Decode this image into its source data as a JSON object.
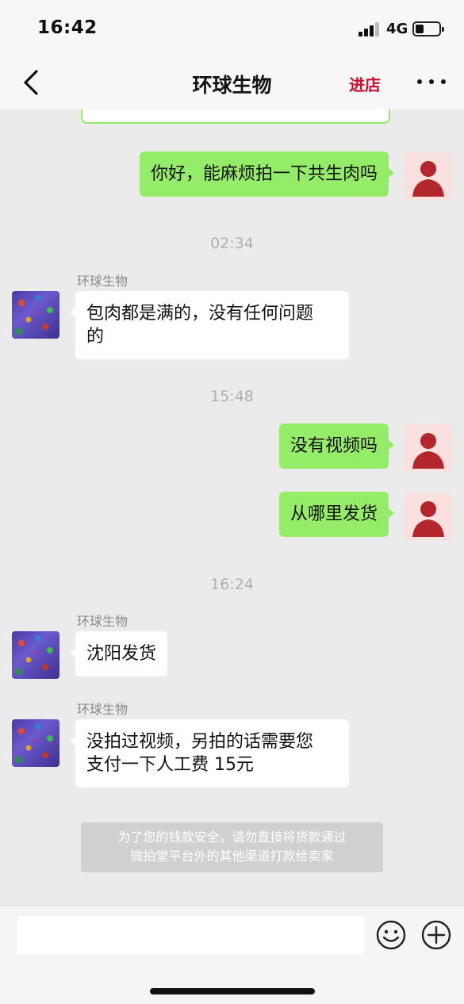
{
  "status_bar": {
    "time": "16:42",
    "network": "4G"
  },
  "nav": {
    "title": "环球生物",
    "enter_shop": "进店"
  },
  "timestamps": {
    "t1": "02:34",
    "t2": "15:48",
    "t3": "16:24"
  },
  "seller_name": "环球生物",
  "messages": {
    "m1": "你好，能麻烦拍一下共生肉吗",
    "m2_line1": "包肉都是满的，没有任何问题",
    "m2_line2": "的",
    "m3": "没有视频吗",
    "m4": "从哪里发货",
    "m5": "沈阳发货",
    "m6_line1": "没拍过视频，另拍的话需要您",
    "m6_line2": "支付一下人工费 15元"
  },
  "system_notice": {
    "line1": "为了您的钱款安全，请勿直接将货款通过",
    "line2": "微拍堂平台外的其他渠道打款给卖家"
  },
  "input": {
    "placeholder": ""
  },
  "colors": {
    "outgoing_bubble": "#95ec69",
    "brand_red": "#c8102e",
    "background": "#ebebeb"
  },
  "icons": [
    "back-icon",
    "more-icon",
    "emoji-icon",
    "plus-icon",
    "signal-icon",
    "battery-icon"
  ]
}
